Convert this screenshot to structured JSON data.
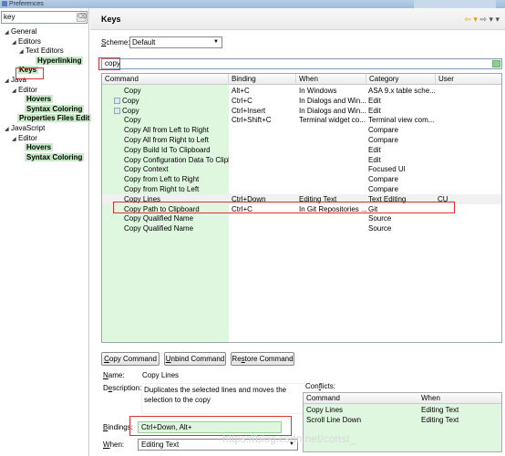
{
  "window": {
    "title": "Preferences"
  },
  "left": {
    "filter_value": "key",
    "tree": [
      {
        "label": "General",
        "level": 0,
        "arrow": "◢"
      },
      {
        "label": "Editors",
        "level": 1,
        "arrow": "◢"
      },
      {
        "label": "Text Editors",
        "level": 2,
        "arrow": "◢"
      },
      {
        "label": "Hyperlinking",
        "level": 3,
        "arrow": "",
        "style": "hl"
      },
      {
        "label": "Keys",
        "level": 1,
        "arrow": "",
        "style": "hl"
      },
      {
        "label": "Java",
        "level": 0,
        "arrow": "◢"
      },
      {
        "label": "Editor",
        "level": 1,
        "arrow": "◢"
      },
      {
        "label": "Hovers",
        "level": 2,
        "arrow": "",
        "style": "hl"
      },
      {
        "label": "Syntax Coloring",
        "level": 2,
        "arrow": "",
        "style": "hl"
      },
      {
        "label": "Properties Files Edit",
        "level": 1,
        "arrow": "",
        "style": "hl"
      },
      {
        "label": "JavaScript",
        "level": 0,
        "arrow": "◢"
      },
      {
        "label": "Editor",
        "level": 1,
        "arrow": "◢"
      },
      {
        "label": "Hovers",
        "level": 2,
        "arrow": "",
        "style": "hl"
      },
      {
        "label": "Syntax Coloring",
        "level": 2,
        "arrow": "",
        "style": "hl"
      }
    ]
  },
  "page": {
    "title": "Keys",
    "nav_back": "⇦ ▾",
    "nav_forward": "⇨ ▾ ▾",
    "scheme_label": "Scheme:",
    "scheme_value": "Default",
    "search_value": "copy"
  },
  "table": {
    "headers": [
      "Command",
      "Binding",
      "When",
      "Category",
      "User"
    ],
    "rows": [
      {
        "command": "Copy",
        "binding": "Alt+C",
        "when": "In Windows",
        "category": "ASA 9.x table sche...",
        "user": "",
        "icon": false
      },
      {
        "command": "Copy",
        "binding": "Ctrl+C",
        "when": "In Dialogs and Win...",
        "category": "Edit",
        "user": "",
        "icon": true
      },
      {
        "command": "Copy",
        "binding": "Ctrl+Insert",
        "when": "In Dialogs and Win...",
        "category": "Edit",
        "user": "",
        "icon": true
      },
      {
        "command": "Copy",
        "binding": "Ctrl+Shift+C",
        "when": "Terminal widget co...",
        "category": "Terminal view com...",
        "user": "",
        "icon": false
      },
      {
        "command": "Copy All from Left to Right",
        "binding": "",
        "when": "",
        "category": "Compare",
        "user": "",
        "icon": false
      },
      {
        "command": "Copy All from Right to Left",
        "binding": "",
        "when": "",
        "category": "Compare",
        "user": "",
        "icon": false
      },
      {
        "command": "Copy Build Id To Clipboard",
        "binding": "",
        "when": "",
        "category": "Edit",
        "user": "",
        "icon": false
      },
      {
        "command": "Copy Configuration Data To Clipb",
        "binding": "",
        "when": "",
        "category": "Edit",
        "user": "",
        "icon": false
      },
      {
        "command": "Copy Context",
        "binding": "",
        "when": "",
        "category": "Focused UI",
        "user": "",
        "icon": false
      },
      {
        "command": "Copy from Left to Right",
        "binding": "",
        "when": "",
        "category": "Compare",
        "user": "",
        "icon": false
      },
      {
        "command": "Copy from Right to Left",
        "binding": "",
        "when": "",
        "category": "Compare",
        "user": "",
        "icon": false
      },
      {
        "command": "Copy Lines",
        "binding": "Ctrl+Down",
        "when": "Editing Text",
        "category": "Text Editing",
        "user": "CU",
        "icon": false
      },
      {
        "command": "Copy Path to Clipboard",
        "binding": "Ctrl+C",
        "when": "In Git Repositories ...",
        "category": "Git",
        "user": "",
        "icon": false
      },
      {
        "command": "Copy Qualified Name",
        "binding": "",
        "when": "",
        "category": "Source",
        "user": "",
        "icon": false
      },
      {
        "command": "Copy Qualified Name",
        "binding": "",
        "when": "",
        "category": "Source",
        "user": "",
        "icon": false
      }
    ]
  },
  "buttons": {
    "copy_pre": "",
    "copy_u": "C",
    "copy_post": "opy Command",
    "unbind_pre": "",
    "unbind_u": "U",
    "unbind_post": "nbind Command",
    "restore_pre": "Re",
    "restore_u": "s",
    "restore_post": "tore Command"
  },
  "details": {
    "name_label": "Name:",
    "name_value": "Copy Lines",
    "desc_label": "Description:",
    "desc_value": "Duplicates the selected lines and moves the selection to the copy",
    "bindings_label": "Bindings:",
    "bindings_value": "Ctrl+Down, Alt+",
    "when_label": "When:",
    "when_value": "Editing Text",
    "conflicts_label": "Conflicts:",
    "conflicts_headers": [
      "Command",
      "When"
    ],
    "conflicts_rows": [
      {
        "command": "Copy Lines",
        "when": "Editing Text"
      },
      {
        "command": "Scroll Line Down",
        "when": "Editing Text"
      }
    ]
  },
  "watermark": "https://blog.csdn.net/const_"
}
